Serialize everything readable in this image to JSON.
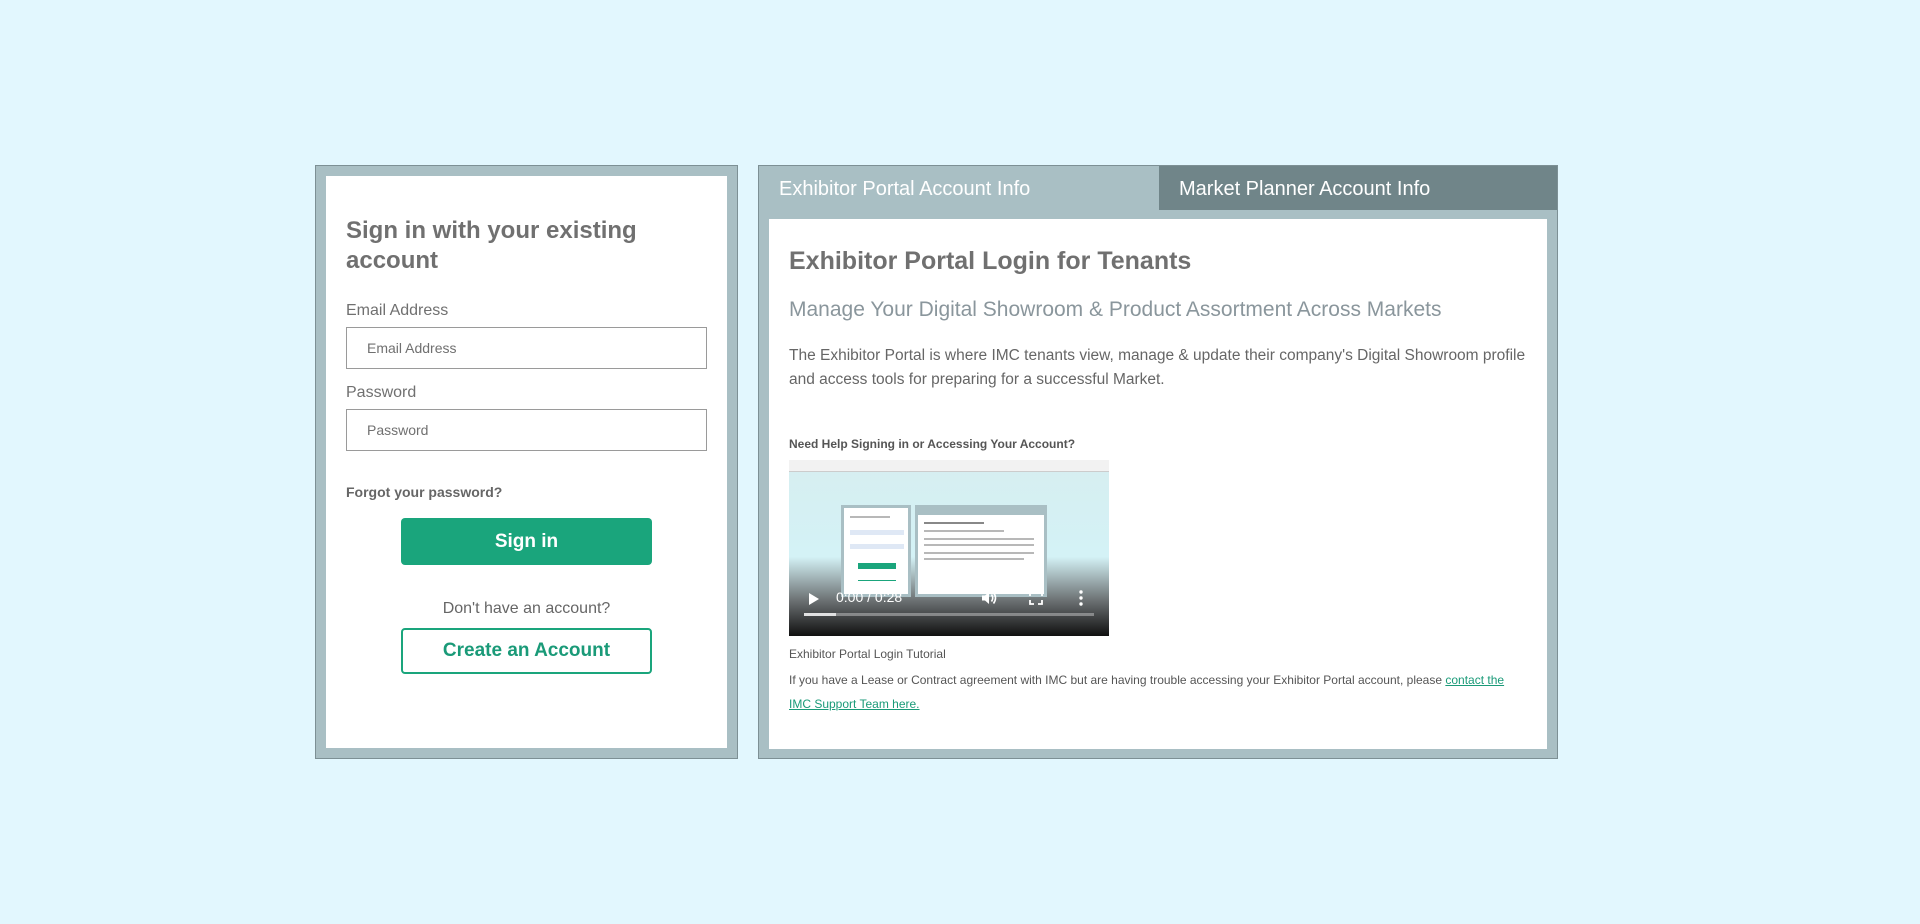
{
  "signin": {
    "title": "Sign in with your existing account",
    "email_label": "Email Address",
    "email_placeholder": "Email Address",
    "email_value": "",
    "password_label": "Password",
    "password_placeholder": "Password",
    "password_value": "",
    "forgot_label": "Forgot your password?",
    "signin_button": "Sign in",
    "no_account_text": "Don't have an account?",
    "create_button": "Create an Account"
  },
  "tabs": [
    {
      "label": "Exhibitor Portal Account Info",
      "active": true
    },
    {
      "label": "Market Planner Account Info",
      "active": false
    }
  ],
  "info": {
    "title": "Exhibitor Portal Login for Tenants",
    "subtitle": "Manage Your Digital Showroom & Product Assortment Across Markets",
    "description": "The Exhibitor Portal is where IMC tenants view, manage & update their company's Digital Showroom profile and access tools for preparing for a successful Market.",
    "help_heading": "Need Help Signing in or Accessing Your Account?",
    "video": {
      "time": "0:00 / 0:28",
      "buffered_fraction": 0.11
    },
    "video_caption": "Exhibitor Portal Login Tutorial",
    "support_text": "If you have a Lease or Contract agreement with IMC but are having trouble accessing your Exhibitor Portal account, please ",
    "support_link": "contact the IMC Support Team here."
  },
  "colors": {
    "background": "#e2f7fe",
    "accent_green": "#1aa57c",
    "frame": "#a9bfc4",
    "tab_inactive": "#708589"
  },
  "icons": [
    "play-icon",
    "volume-icon",
    "fullscreen-icon",
    "more-vertical-icon"
  ]
}
